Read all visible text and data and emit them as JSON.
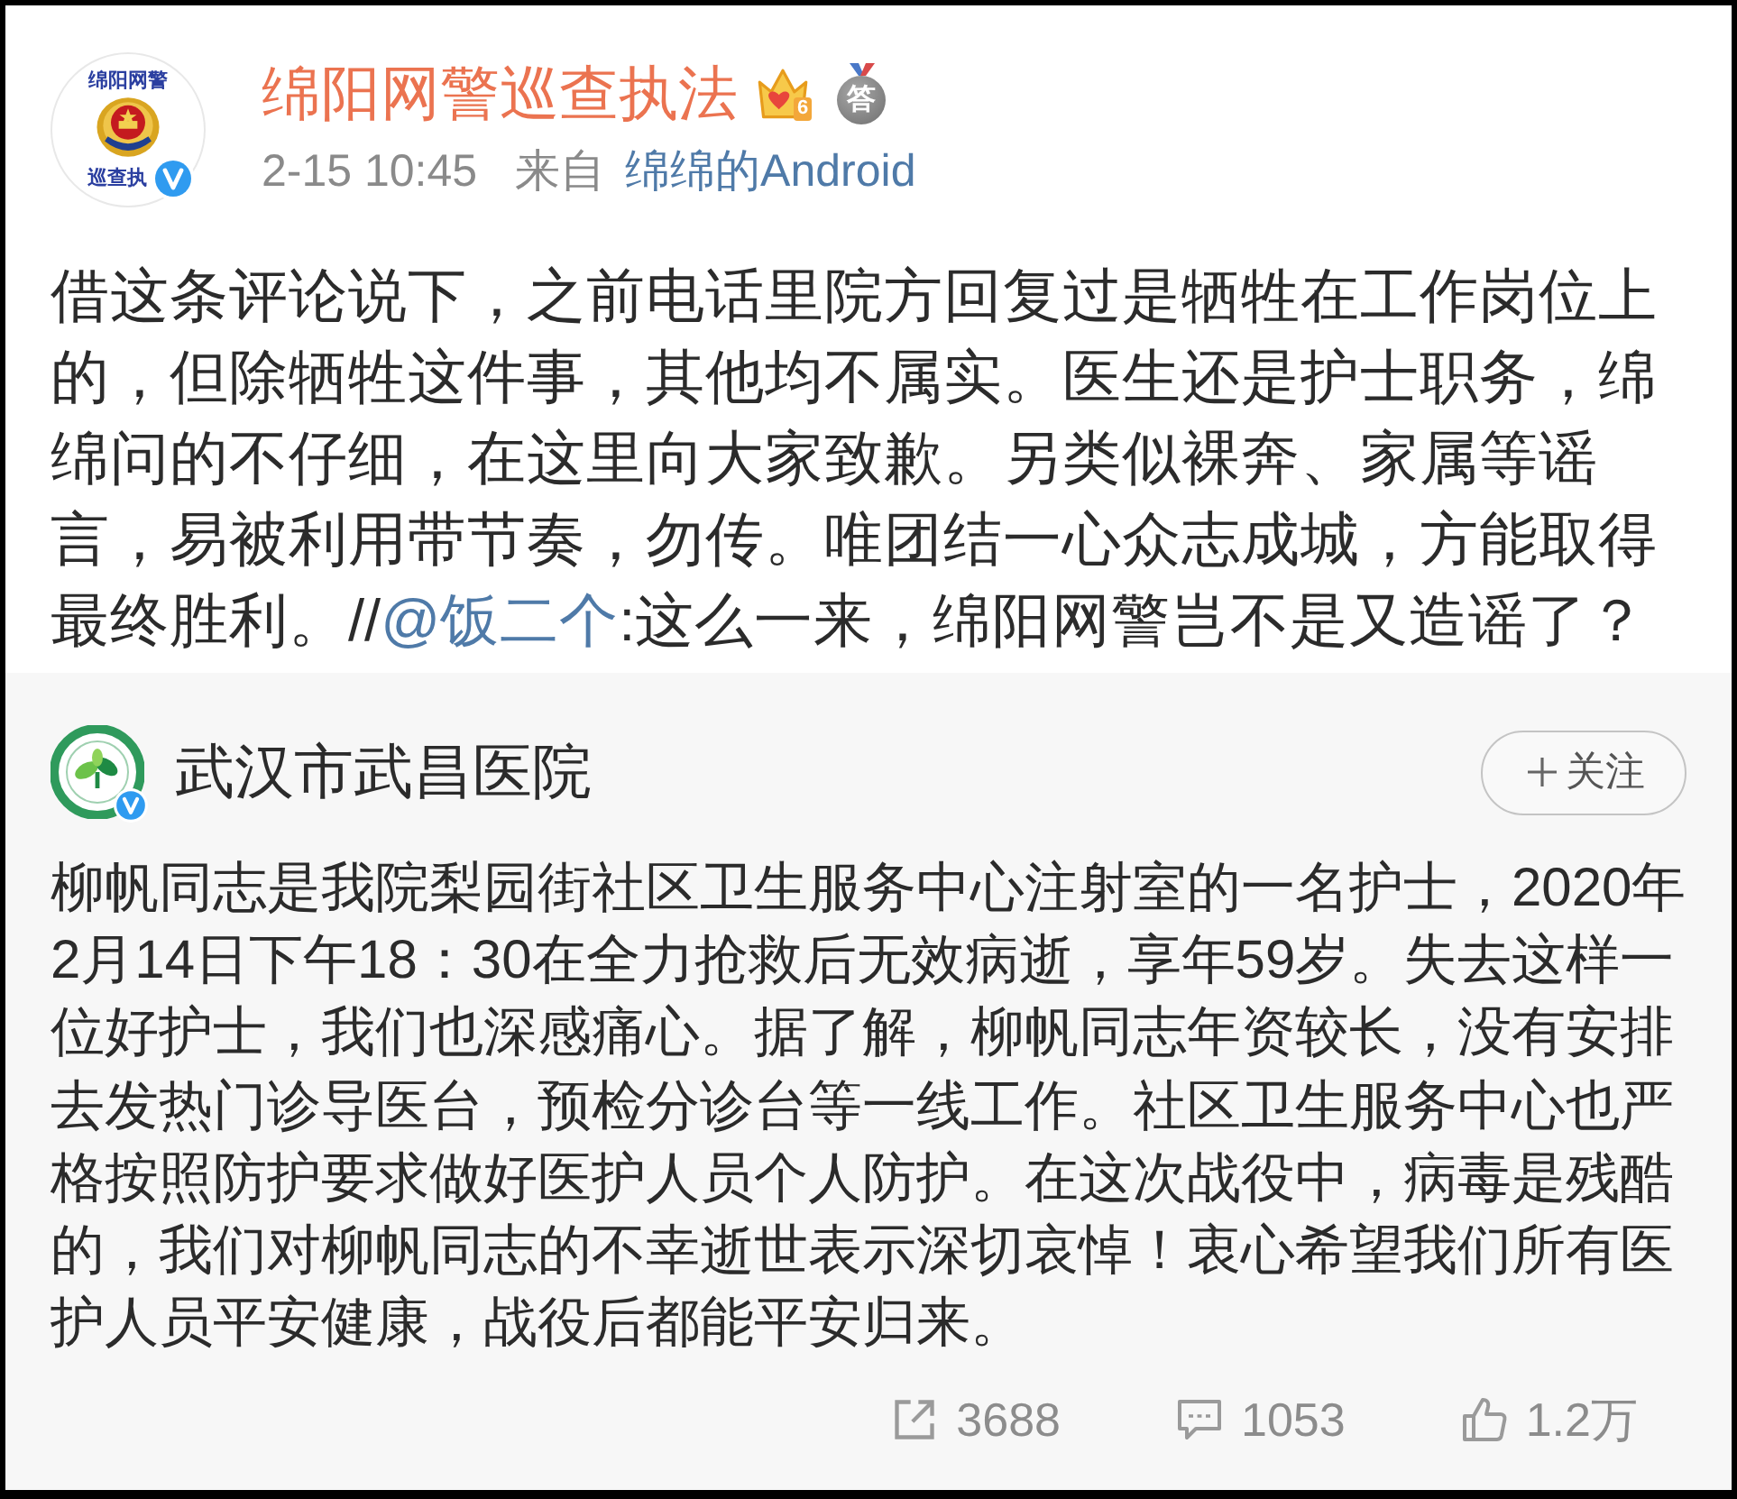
{
  "post": {
    "author": {
      "name": "绵阳网警巡查执法",
      "avatar_text_top": "绵阳网警",
      "avatar_text_bottom": "巡查执",
      "verified": true,
      "vip_level": "6",
      "medal": "答"
    },
    "time": "2-15 10:45",
    "source_prefix": "来自",
    "source": "绵绵的Android",
    "text": [
      {
        "kind": "text",
        "text": "借这条评论说下，之前电话里院方回复过是牺牲在工作岗位上的，但除牺牲这件事，其他均不属实。医生还是护士职务，绵绵问的不仔细，在这里向大家致歉。另类似裸奔、家属等谣言，易被利用带节奏，勿传。唯团结一心众志成城，方能取得最终胜利。//"
      },
      {
        "kind": "mention",
        "text": "@饭二个"
      },
      {
        "kind": "text",
        "text": ":这么一来，绵阳网警岂不是又造谣了？"
      }
    ]
  },
  "retweet": {
    "author": {
      "name": "武汉市武昌医院",
      "verified": true
    },
    "follow_button": {
      "label": "关注"
    },
    "text": "柳帆同志是我院梨园街社区卫生服务中心注射室的一名护士，2020年2月14日下午18：30在全力抢救后无效病逝，享年59岁。失去这样一位好护士，我们也深感痛心。据了解，柳帆同志年资较长，没有安排去发热门诊导医台，预检分诊台等一线工作。社区卫生服务中心也严格按照防护要求做好医护人员个人防护。在这次战役中，病毒是残酷的，我们对柳帆同志的不幸逝世表示深切哀悼！衷心希望我们所有医护人员平安健康，战役后都能平安归来。",
    "stats": [
      {
        "kind": "repost",
        "count": "3688"
      },
      {
        "kind": "comment",
        "count": "1053"
      },
      {
        "kind": "like",
        "count": "1.2万"
      }
    ]
  }
}
